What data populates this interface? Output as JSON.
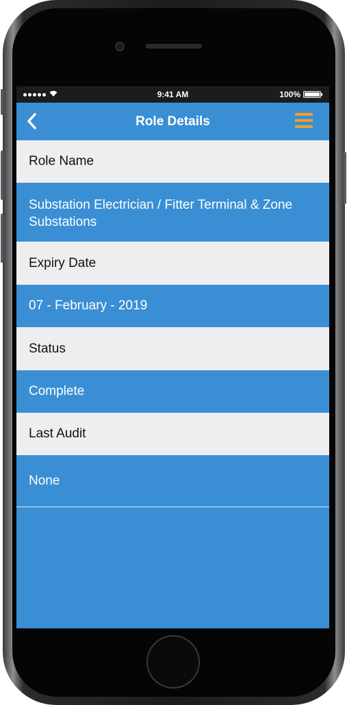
{
  "status_bar": {
    "time": "9:41 AM",
    "battery": "100%",
    "battery_level": 1.0,
    "signal_icon": "signal-dots-icon",
    "wifi_icon": "wifi-icon"
  },
  "nav": {
    "title": "Role Details",
    "back_icon": "chevron-left-icon",
    "menu_icon": "hamburger-menu-icon"
  },
  "details": {
    "role_name_label": "Role Name",
    "role_name_value": "Substation Electrician / Fitter Terminal & Zone Substations",
    "expiry_date_label": "Expiry Date",
    "expiry_date_value": "07 - February - 2019",
    "status_label": "Status",
    "status_value": "Complete",
    "last_audit_label": "Last Audit",
    "last_audit_value": "None"
  },
  "colors": {
    "accent": "#3a8fd4",
    "label_row_bg": "#eeeef0",
    "menu_icon": "#f0a030"
  }
}
